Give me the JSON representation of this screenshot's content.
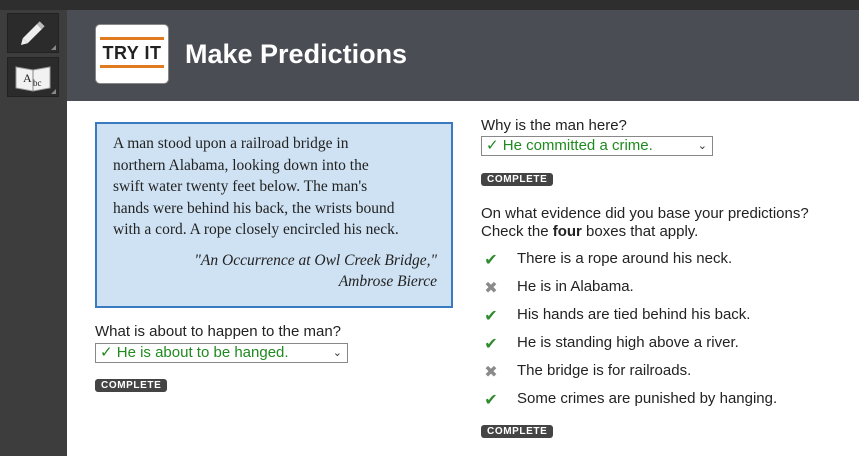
{
  "app": {
    "title": "Make Predictions",
    "logo_text": "TRY IT",
    "accent_color": "#e07b20"
  },
  "toolbar": {
    "items": [
      {
        "icon": "pencil-icon"
      },
      {
        "icon": "dictionary-icon",
        "glyph": "Abc"
      }
    ]
  },
  "passage": {
    "lines": [
      "A man stood upon a railroad bridge in",
      "northern Alabama, looking down into the",
      "swift water twenty feet below. The man's",
      "hands were behind his back, the wrists bound",
      "with a cord. A rope closely encircled his neck."
    ],
    "cite_title": "\"An Occurrence at Owl Creek Bridge,\"",
    "cite_author": "Ambrose Bierce"
  },
  "q1": {
    "question": "What is about to happen to the man?",
    "answer": "He is about to be hanged.",
    "status": "COMPLETE"
  },
  "q2": {
    "question": "Why is the man here?",
    "answer": "He committed a crime.",
    "status": "COMPLETE"
  },
  "q3": {
    "question_line1": "On what evidence did you base your predictions?",
    "question_pre": "Check the ",
    "question_bold": "four",
    "question_post": " boxes that apply.",
    "options": [
      {
        "label": "There is a rope around his neck.",
        "state": "correct",
        "mark": "✔"
      },
      {
        "label": "He is in Alabama.",
        "state": "incorrect",
        "mark": "✖"
      },
      {
        "label": "His hands are tied behind his back.",
        "state": "correct",
        "mark": "✔"
      },
      {
        "label": "He is standing high above a river.",
        "state": "correct",
        "mark": "✔"
      },
      {
        "label": "The bridge is for railroads.",
        "state": "incorrect",
        "mark": "✖"
      },
      {
        "label": "Some crimes are punished by hanging.",
        "state": "correct",
        "mark": "✔"
      }
    ],
    "status": "COMPLETE"
  },
  "check_glyph": "✓",
  "dropdown_glyph": "⌄"
}
